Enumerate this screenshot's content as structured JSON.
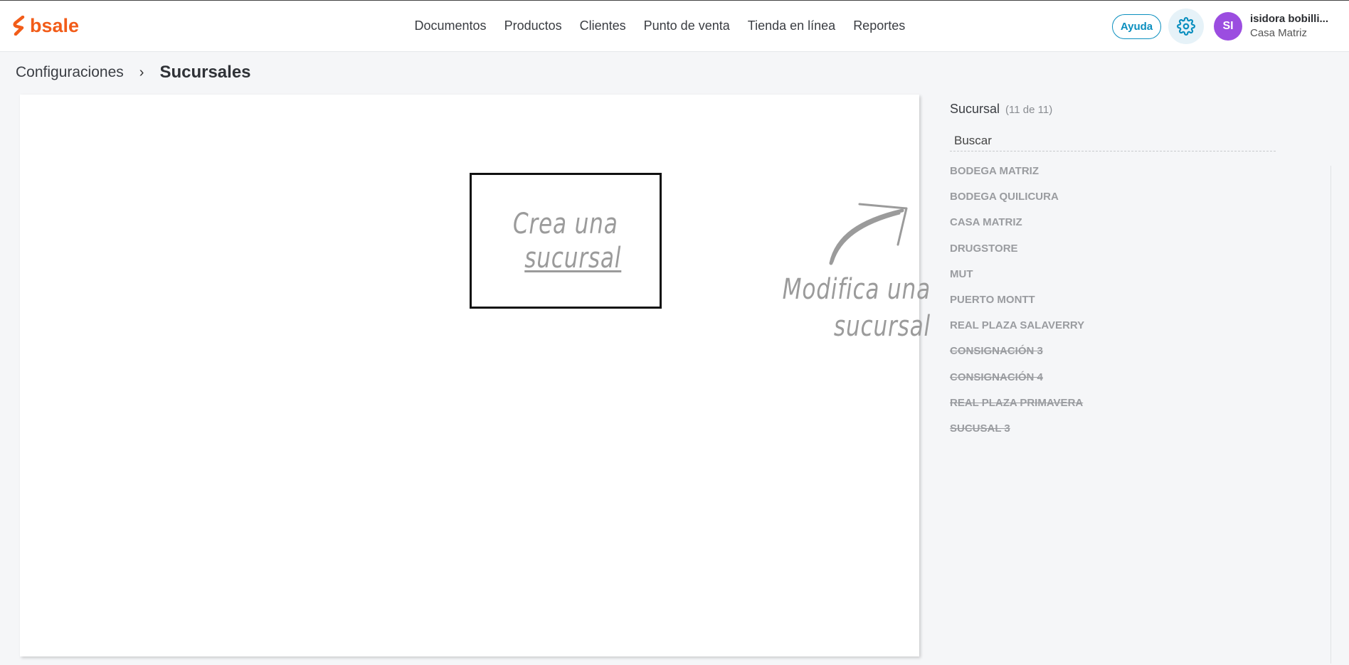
{
  "brand": {
    "logo_text": "bsale",
    "logo_color": "#f25c19"
  },
  "nav": {
    "items": [
      {
        "label": "Documentos"
      },
      {
        "label": "Productos"
      },
      {
        "label": "Clientes"
      },
      {
        "label": "Punto de venta"
      },
      {
        "label": "Tienda en línea"
      },
      {
        "label": "Reportes"
      }
    ]
  },
  "header": {
    "help_label": "Ayuda",
    "settings_icon": "gear-icon",
    "avatar_initials": "SI",
    "avatar_color": "#9b4de0",
    "user_name": "isidora bobilli...",
    "user_branch": "Casa Matriz"
  },
  "breadcrumb": {
    "parent": "Configuraciones",
    "separator": "›",
    "current": "Sucursales"
  },
  "main": {
    "create_line1": "Crea una",
    "create_line2": "sucursal",
    "modify_line1": "Modifica una",
    "modify_line2": "sucursal"
  },
  "sidebar": {
    "title": "Sucursal",
    "count": "(11 de 11)",
    "search_placeholder": "Buscar",
    "branches": [
      {
        "name": "BODEGA MATRIZ",
        "inactive": false
      },
      {
        "name": "BODEGA QUILICURA",
        "inactive": false
      },
      {
        "name": "CASA MATRIZ",
        "inactive": false
      },
      {
        "name": "DRUGSTORE",
        "inactive": false
      },
      {
        "name": "MUT",
        "inactive": false
      },
      {
        "name": "PUERTO MONTT",
        "inactive": false
      },
      {
        "name": "REAL PLAZA SALAVERRY",
        "inactive": false
      },
      {
        "name": "CONSIGNACIÓN 3",
        "inactive": true
      },
      {
        "name": "CONSIGNACIÓN 4",
        "inactive": true
      },
      {
        "name": "REAL PLAZA PRIMAVERA",
        "inactive": true
      },
      {
        "name": "SUCUSAL 3",
        "inactive": true
      }
    ]
  }
}
